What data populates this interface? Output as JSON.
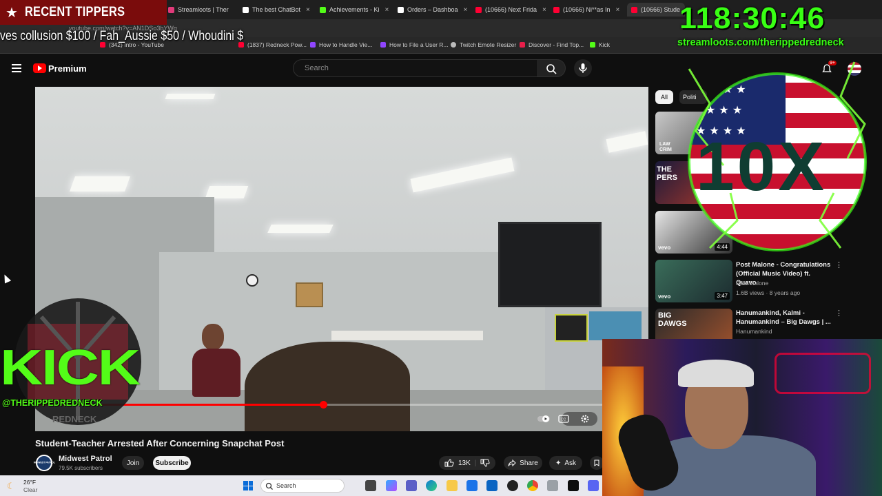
{
  "overlay": {
    "tipper_label": "RECENT TIPPERS",
    "ticker_text": "ves collusion $100 / Fah_Aussie $50 / Whoudini $",
    "timer": "118:30:46",
    "timer_url": "streamloots.com/therippedredneck",
    "kick_text": "KICK",
    "kick_handle": "@THERIPPEDREDNECK",
    "emblem_text": "10X"
  },
  "browser": {
    "tabs": [
      {
        "label": "Streamloots | Ther",
        "color": "#e13a7a"
      },
      {
        "label": "The best ChatBot",
        "color": "#ffffff"
      },
      {
        "label": "Achievements - Ki",
        "color": "#53fc18"
      },
      {
        "label": "Orders – Dashboa",
        "color": "#ffffff"
      },
      {
        "label": "(10666) Next Frida",
        "color": "#ff0033"
      },
      {
        "label": "(10666) Ni**as In",
        "color": "#ff0033"
      },
      {
        "label": "(10666) Stude",
        "color": "#ff0033"
      }
    ],
    "url": "youtube.com/watch?v=AN1DSo3bYWg",
    "bookmarks": [
      {
        "label": "(342) Intro - YouTube",
        "color": "#ff0033"
      },
      {
        "label": "(1837) Redneck Pow...",
        "color": "#ff0033"
      },
      {
        "label": "How to Handle Vie...",
        "color": "#9146ff"
      },
      {
        "label": "How to File a User R...",
        "color": "#9146ff"
      },
      {
        "label": "Twitch Emote Resizer",
        "color": "#bbbbbb"
      },
      {
        "label": "Discover - Find Top...",
        "color": "#e91e4a"
      },
      {
        "label": "Kick",
        "color": "#53fc18"
      }
    ]
  },
  "youtube": {
    "brand": "Premium",
    "search_placeholder": "Search",
    "notification_badge": "9+",
    "video_title": "Student-Teacher Arrested After Concerning Snapchat Post",
    "channel_name": "Midwest Patrol",
    "channel_avatar_text": "MIDWEST PATROL",
    "channel_subs": "79.5K subscribers",
    "join_label": "Join",
    "subscribe_label": "Subscribe",
    "likes": "13K",
    "share_label": "Share",
    "ask_label": "Ask",
    "progress": 0.47,
    "chips": [
      "All",
      "Politi"
    ],
    "recommendations": [
      {
        "thumb_text": "LAW CRIM",
        "title": "",
        "channel": "",
        "meta": "",
        "duration": ""
      },
      {
        "thumb_text": "THE PERS",
        "title": "",
        "channel": "",
        "meta": "",
        "duration": ""
      },
      {
        "thumb_text": "vevo",
        "title": "",
        "channel": "",
        "meta": "",
        "duration": "4:44"
      },
      {
        "thumb_text": "vevo",
        "title": "Post Malone - Congratulations (Official Music Video) ft. Quavo",
        "channel": "Post Malone",
        "meta": "1.6B views · 8 years ago",
        "duration": "3:47"
      },
      {
        "thumb_text": "BIG DAWGS",
        "title": "Hanumankind, Kalmi - Hanumankind – Big Dawgs | ...",
        "channel": "Hanumankind",
        "meta": "",
        "duration": ""
      }
    ]
  },
  "taskbar": {
    "temperature": "26°F",
    "condition": "Clear",
    "search_label": "Search"
  }
}
